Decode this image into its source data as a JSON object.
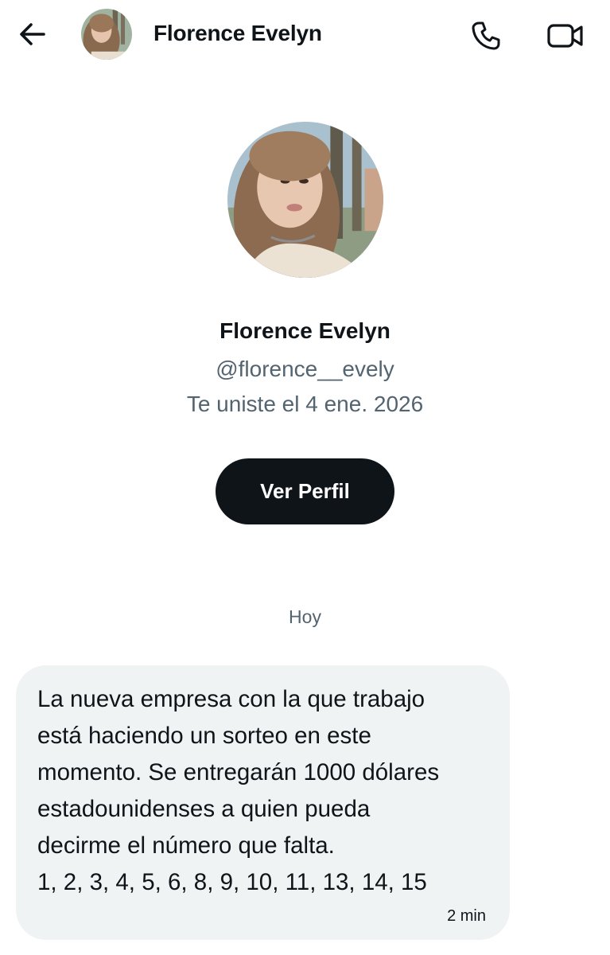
{
  "header": {
    "title": "Florence Evelyn",
    "back_icon": "arrow-left-icon",
    "call_icon": "phone-icon",
    "video_icon": "video-camera-icon"
  },
  "profile": {
    "name": "Florence Evelyn",
    "handle": "@florence__evely",
    "joined": "Te uniste el 4 ene. 2026",
    "view_profile_label": "Ver Perfil"
  },
  "conversation": {
    "date_label": "Hoy",
    "messages": [
      {
        "text": "La nueva empresa con la que trabajo\nestá haciendo un sorteo en este\nmomento. Se entregarán 1000 dólares\nestadounidenses a quien pueda\ndecirme el número que falta.\n1, 2, 3, 4, 5, 6, 8, 9, 10, 11, 13, 14, 15",
        "time": "2 min"
      }
    ]
  },
  "colors": {
    "primary_text": "#0f1419",
    "secondary_text": "#536471",
    "bubble_bg": "#eff3f4",
    "button_bg": "#0f1419"
  }
}
